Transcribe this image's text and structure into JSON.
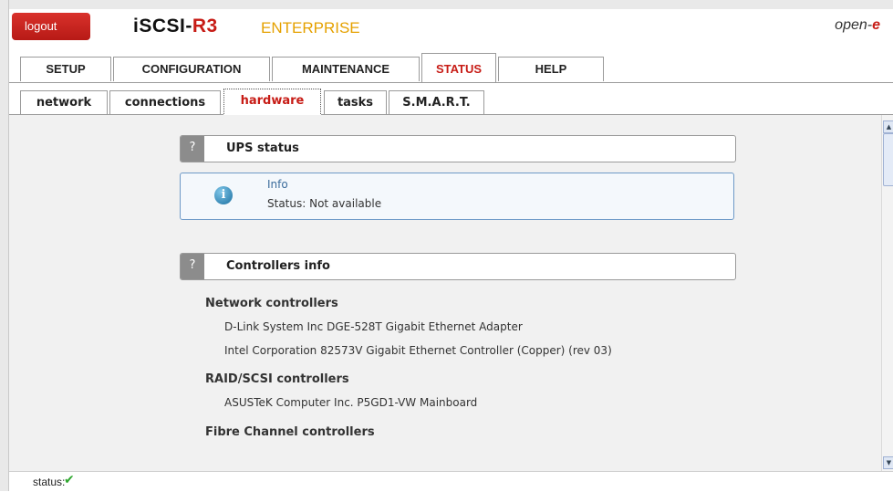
{
  "header": {
    "logout_label": "logout",
    "brand_name": "iSCSI-",
    "brand_version": "R3",
    "edition": "ENTERPRISE",
    "vendor_name": "open-",
    "vendor_suffix": "e"
  },
  "main_tabs": [
    {
      "label": "SETUP",
      "active": false
    },
    {
      "label": "CONFIGURATION",
      "active": false
    },
    {
      "label": "MAINTENANCE",
      "active": false
    },
    {
      "label": "STATUS",
      "active": true
    },
    {
      "label": "HELP",
      "active": false
    }
  ],
  "sub_tabs": [
    {
      "label": "network",
      "active": false
    },
    {
      "label": "connections",
      "active": false
    },
    {
      "label": "hardware",
      "active": true
    },
    {
      "label": "tasks",
      "active": false
    },
    {
      "label": "S.M.A.R.T.",
      "active": false
    }
  ],
  "ups": {
    "help_label": "?",
    "title": "UPS status",
    "info_icon_glyph": "i",
    "info_label": "Info",
    "info_text": "Status: Not available"
  },
  "controllers": {
    "help_label": "?",
    "title": "Controllers info",
    "groups": [
      {
        "title": "Network controllers",
        "devices": [
          "D-Link System Inc DGE-528T Gigabit Ethernet Adapter",
          "Intel Corporation 82573V Gigabit Ethernet Controller (Copper) (rev 03)"
        ]
      },
      {
        "title": "RAID/SCSI controllers",
        "devices": [
          "ASUSTeK Computer Inc. P5GD1-VW Mainboard"
        ]
      },
      {
        "title": "Fibre Channel controllers",
        "devices": []
      }
    ]
  },
  "statusbar": {
    "label": "status:",
    "check_icon": "check-icon",
    "check_glyph": "✔"
  },
  "colors": {
    "accent_red": "#c71c16",
    "edition_orange": "#e5a100",
    "info_border": "#6d99c7",
    "ok_green": "#2fa82f"
  }
}
